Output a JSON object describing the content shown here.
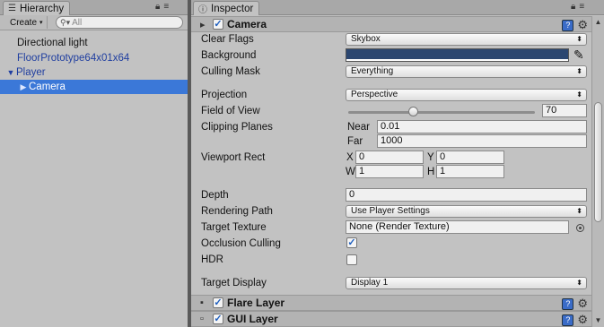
{
  "hierarchy": {
    "tab_label": "Hierarchy",
    "create_label": "Create",
    "search_placeholder": "All",
    "items": [
      {
        "label": "Directional light",
        "expanded": null
      },
      {
        "label": "FloorPrototype64x01x64",
        "expanded": null
      },
      {
        "label": "Player",
        "expanded": true
      },
      {
        "label": "Camera",
        "expanded": false
      }
    ]
  },
  "inspector": {
    "tab_label": "Inspector",
    "camera": {
      "title": "Camera",
      "enabled": true,
      "props": {
        "clear_flags": {
          "label": "Clear Flags",
          "value": "Skybox"
        },
        "background": {
          "label": "Background",
          "color": "#2b4670"
        },
        "culling_mask": {
          "label": "Culling Mask",
          "value": "Everything"
        },
        "projection": {
          "label": "Projection",
          "value": "Perspective"
        },
        "fov": {
          "label": "Field of View",
          "value": "70",
          "slider_level": 0.35
        },
        "clipping": {
          "label": "Clipping Planes",
          "near_label": "Near",
          "near": "0.01",
          "far_label": "Far",
          "far": "1000"
        },
        "viewport": {
          "label": "Viewport Rect",
          "x_label": "X",
          "x": "0",
          "y_label": "Y",
          "y": "0",
          "w_label": "W",
          "w": "1",
          "h_label": "H",
          "h": "1"
        },
        "depth": {
          "label": "Depth",
          "value": "0"
        },
        "rendering_path": {
          "label": "Rendering Path",
          "value": "Use Player Settings"
        },
        "target_texture": {
          "label": "Target Texture",
          "value": "None (Render Texture)"
        },
        "occlusion_culling": {
          "label": "Occlusion Culling",
          "checked": true
        },
        "hdr": {
          "label": "HDR",
          "checked": false
        },
        "target_display": {
          "label": "Target Display",
          "value": "Display 1"
        }
      }
    },
    "flare_layer": {
      "title": "Flare Layer",
      "enabled": true
    },
    "gui_layer": {
      "title": "GUI Layer",
      "enabled": true
    }
  }
}
